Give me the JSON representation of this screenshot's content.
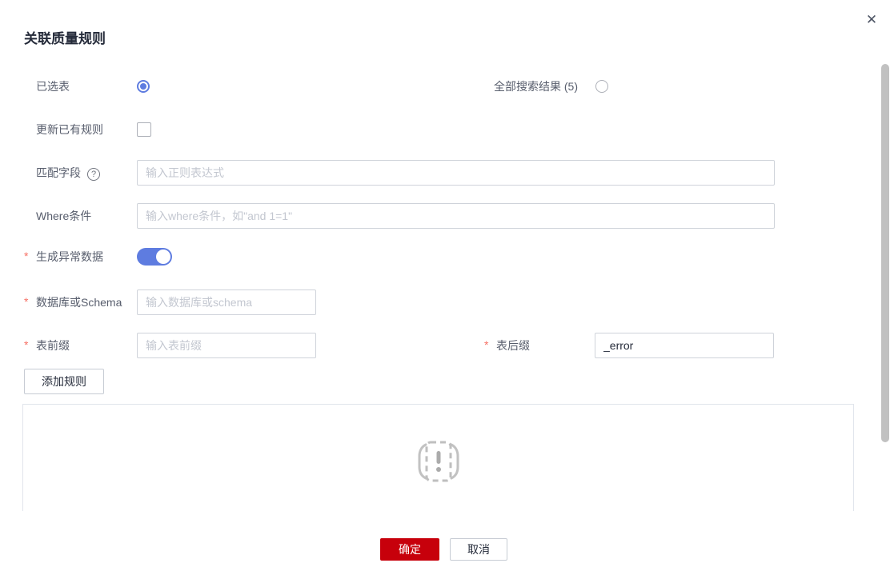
{
  "dialog": {
    "title": "关联质量规则",
    "close_glyph": "✕"
  },
  "form": {
    "scope": {
      "selected_label": "已选表",
      "selected_checked": true,
      "all_results_label": "全部搜索结果 (5)",
      "all_results_checked": false
    },
    "update_rules": {
      "label": "更新已有规则",
      "checked": false
    },
    "match_field": {
      "label": "匹配字段",
      "help_glyph": "?",
      "placeholder": "输入正则表达式",
      "value": ""
    },
    "where": {
      "label": "Where条件",
      "placeholder": "输入where条件，如\"and 1=1\"",
      "value": ""
    },
    "gen_abnormal": {
      "required_mark": "*",
      "label": "生成异常数据",
      "on": true
    },
    "database": {
      "required_mark": "*",
      "label": "数据库或Schema",
      "placeholder": "输入数据库或schema",
      "value": ""
    },
    "prefix": {
      "required_mark": "*",
      "label": "表前缀",
      "placeholder": "输入表前缀",
      "value": ""
    },
    "suffix": {
      "required_mark": "*",
      "label": "表后缀",
      "value": "_error"
    },
    "add_rule_button": "添加规则"
  },
  "empty_state": {
    "icon": "no-data-exclamation"
  },
  "footer": {
    "ok_label": "确定",
    "cancel_label": "取消"
  },
  "colors": {
    "accent_blue": "#5e7ce0",
    "primary_red": "#c7000b",
    "required_red": "#f66f64",
    "label_gray": "#575d6c",
    "placeholder_gray": "#c3c7d0",
    "border_gray": "#cfd3da",
    "panel_border": "#e1e5ec"
  }
}
